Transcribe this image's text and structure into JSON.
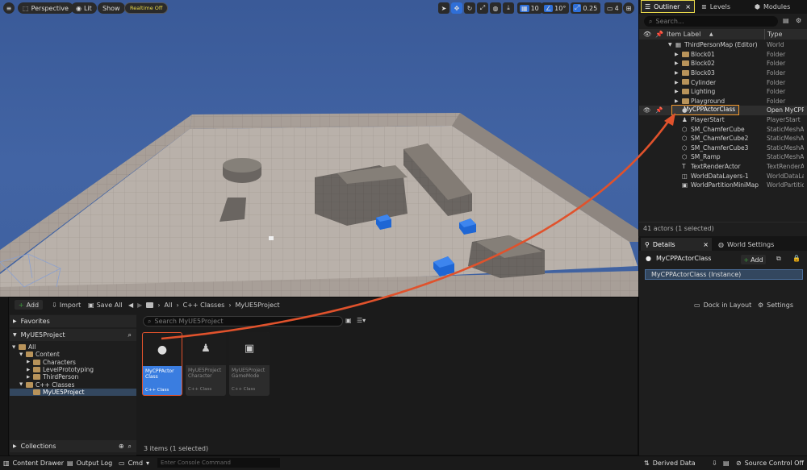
{
  "viewport": {
    "menu_icon": "hamburger-icon",
    "perspective_label": "Perspective",
    "lit_label": "Lit",
    "show_label": "Show",
    "realtime_label": "Realtime Off",
    "grid_snap_value": "10",
    "rotation_snap_value": "10°",
    "scale_snap_value": "0.25",
    "camera_speed_value": "4"
  },
  "outliner": {
    "tabs": [
      {
        "label": "Outliner",
        "icon": "outliner-icon",
        "active": true
      },
      {
        "label": "Levels",
        "icon": "levels-icon"
      },
      {
        "label": "Modules",
        "icon": "modules-icon"
      }
    ],
    "search_placeholder": "Search...",
    "col_label": "Item Label",
    "col_type": "Type",
    "rows": [
      {
        "label": "ThirdPersonMap (Editor)",
        "type": "World",
        "kind": "map",
        "indent": 0
      },
      {
        "label": "Block01",
        "type": "Folder",
        "kind": "folder",
        "indent": 1
      },
      {
        "label": "Block02",
        "type": "Folder",
        "kind": "folder",
        "indent": 1
      },
      {
        "label": "Block03",
        "type": "Folder",
        "kind": "folder",
        "indent": 1
      },
      {
        "label": "Cylinder",
        "type": "Folder",
        "kind": "folder",
        "indent": 1
      },
      {
        "label": "Lighting",
        "type": "Folder",
        "kind": "folder",
        "indent": 1
      },
      {
        "label": "Playground",
        "type": "Folder",
        "kind": "folder",
        "indent": 1
      },
      {
        "label": "MyCPPActorClass",
        "type": "Open MyCPPActorClass",
        "kind": "actor",
        "indent": 1,
        "selected": true
      },
      {
        "label": "PlayerStart",
        "type": "PlayerStart",
        "kind": "playerstart",
        "indent": 1
      },
      {
        "label": "SM_ChamferCube",
        "type": "StaticMeshActor",
        "kind": "mesh",
        "indent": 1
      },
      {
        "label": "SM_ChamferCube2",
        "type": "StaticMeshActor",
        "kind": "mesh",
        "indent": 1
      },
      {
        "label": "SM_ChamferCube3",
        "type": "StaticMeshActor",
        "kind": "mesh",
        "indent": 1
      },
      {
        "label": "SM_Ramp",
        "type": "StaticMeshActor",
        "kind": "mesh",
        "indent": 1
      },
      {
        "label": "TextRenderActor",
        "type": "TextRenderActor",
        "kind": "text",
        "indent": 1
      },
      {
        "label": "WorldDataLayers-1",
        "type": "WorldDataLayers",
        "kind": "layers",
        "indent": 1
      },
      {
        "label": "WorldPartitionMiniMap",
        "type": "WorldPartitionMiniMap",
        "kind": "minimap",
        "indent": 1
      }
    ],
    "status": "41 actors (1 selected)"
  },
  "details": {
    "tab_label": "Details",
    "world_settings_label": "World Settings",
    "actor_name": "MyCPPActorClass",
    "add_label": "Add",
    "instance_label": "MyCPPActorClass (Instance)"
  },
  "content_browser": {
    "add_label": "Add",
    "import_label": "Import",
    "save_all_label": "Save All",
    "breadcrumbs": [
      "All",
      "C++ Classes",
      "MyUE5Project"
    ],
    "dock_label": "Dock in Layout",
    "settings_label": "Settings",
    "favorites_label": "Favorites",
    "project_label": "MyUE5Project",
    "search_placeholder": "Search MyUE5Project",
    "tree": [
      {
        "label": "All",
        "indent": 0,
        "open": true
      },
      {
        "label": "Content",
        "indent": 1,
        "open": true
      },
      {
        "label": "Characters",
        "indent": 2
      },
      {
        "label": "LevelPrototyping",
        "indent": 2
      },
      {
        "label": "ThirdPerson",
        "indent": 2
      },
      {
        "label": "C++ Classes",
        "indent": 1,
        "open": true
      },
      {
        "label": "MyUE5Project",
        "indent": 2,
        "selected": true
      }
    ],
    "assets": [
      {
        "name": "MyCPPActor Class",
        "class": "C++ Class",
        "icon": "actor-sphere-icon",
        "selected": true
      },
      {
        "name": "MyUE5Project Character",
        "class": "C++ Class",
        "icon": "character-icon"
      },
      {
        "name": "MyUE5Project GameMode",
        "class": "C++ Class",
        "icon": "gamemode-monitor-icon"
      }
    ],
    "collections_label": "Collections",
    "items_status": "3 items (1 selected)"
  },
  "statusbar": {
    "content_drawer": "Content Drawer",
    "output_log": "Output Log",
    "cmd": "Cmd",
    "console_placeholder": "Enter Console Command",
    "derived_data": "Derived Data",
    "source_control": "Source Control Off"
  },
  "colors": {
    "accent_blue": "#2f6fd8",
    "highlight_yellow": "#e8d84a",
    "highlight_orange": "#f0962a",
    "arrow_red": "#e0522c",
    "selection_red": "#d9402c"
  }
}
